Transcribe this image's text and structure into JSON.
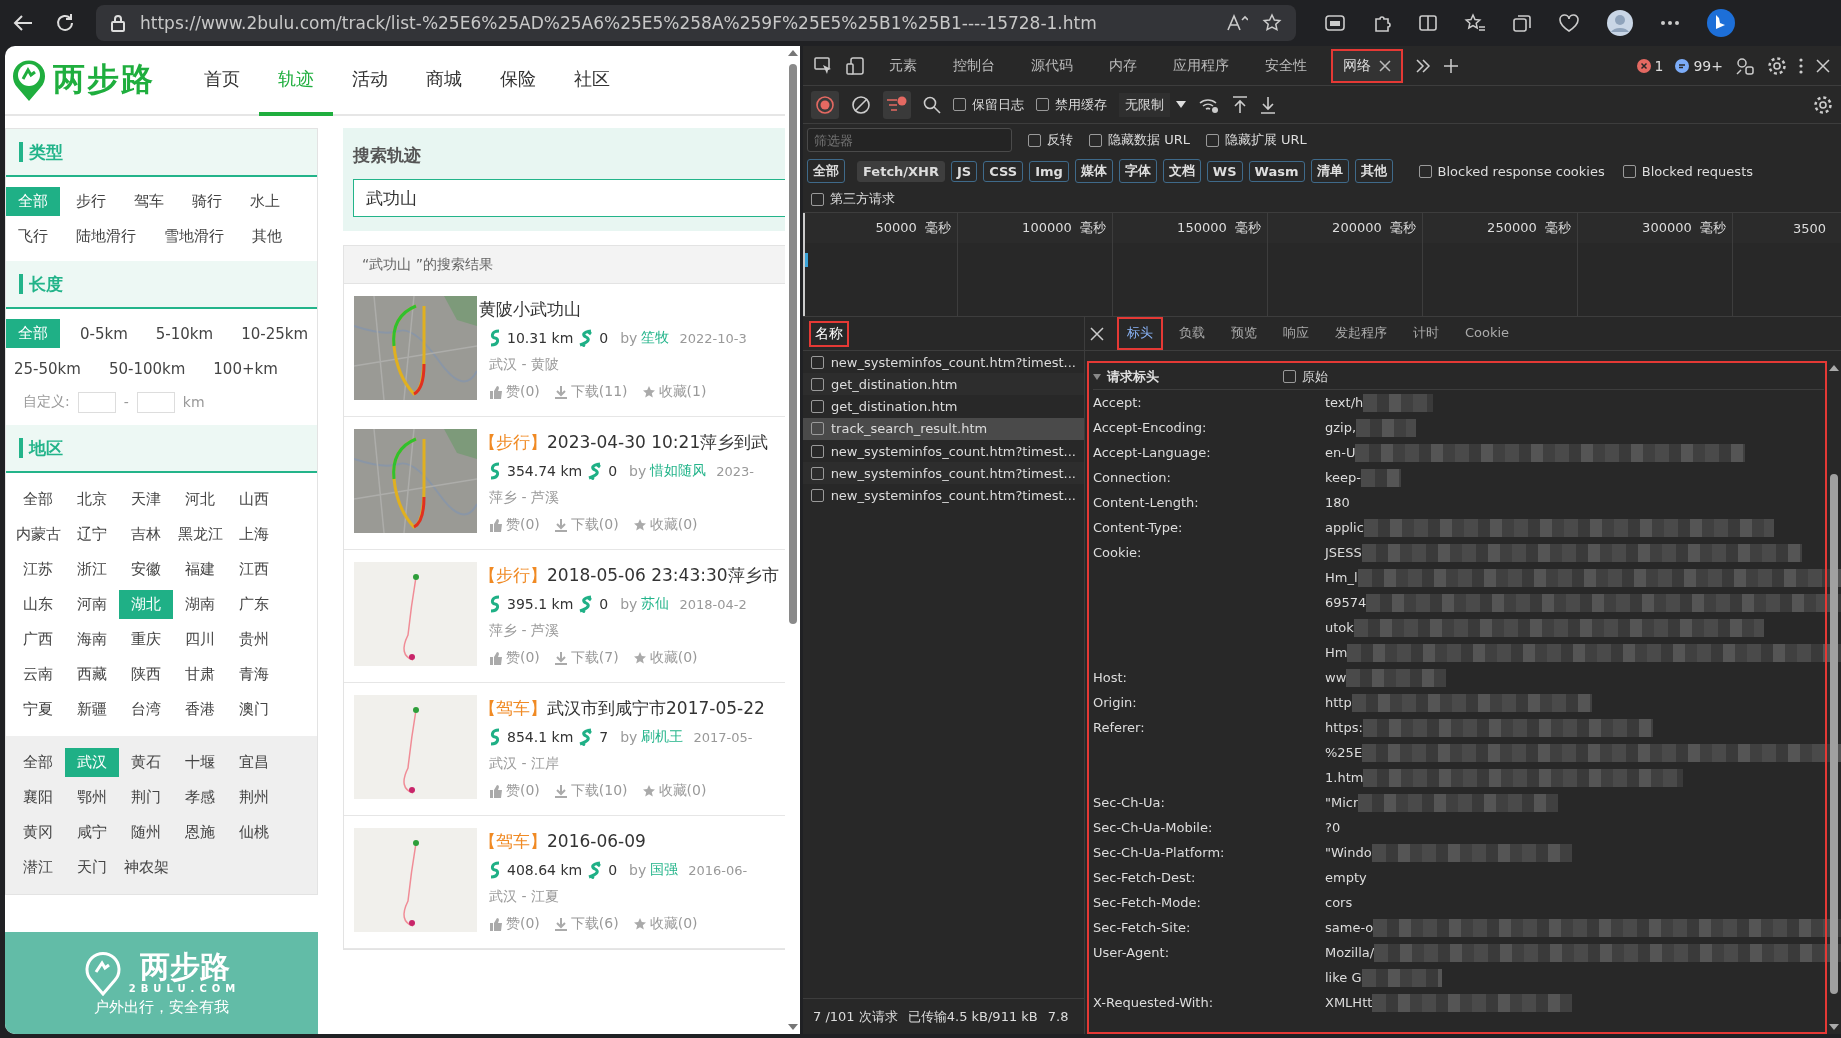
{
  "browser": {
    "url": "https://www.2bulu.com/track/list-%25E6%25AD%25A6%25E5%258A%259F%25E5%25B1%25B1----15728-1.htm"
  },
  "site": {
    "logo": "两步路",
    "nav": [
      {
        "label": "首页",
        "selected": false
      },
      {
        "label": "轨迹",
        "selected": true
      },
      {
        "label": "活动",
        "selected": false
      },
      {
        "label": "商城",
        "selected": false
      },
      {
        "label": "保险",
        "selected": false
      },
      {
        "label": "社区",
        "selected": false
      }
    ],
    "filters": [
      {
        "title": "类型",
        "kind": "options",
        "options": [
          {
            "label": "全部",
            "selected": true
          },
          {
            "label": "步行",
            "selected": false
          },
          {
            "label": "驾车",
            "selected": false
          },
          {
            "label": "骑行",
            "selected": false
          },
          {
            "label": "水上",
            "selected": false
          },
          {
            "label": "飞行",
            "selected": false
          },
          {
            "label": "陆地滑行",
            "selected": false
          },
          {
            "label": "雪地滑行",
            "selected": false
          },
          {
            "label": "其他",
            "selected": false
          }
        ]
      },
      {
        "title": "长度",
        "kind": "options",
        "options": [
          {
            "label": "全部",
            "selected": true
          },
          {
            "label": "0-5km",
            "selected": false
          },
          {
            "label": "5-10km",
            "selected": false
          },
          {
            "label": "10-25km",
            "selected": false
          },
          {
            "label": "25-50km",
            "selected": false
          },
          {
            "label": "50-100km",
            "selected": false
          },
          {
            "label": "100+km",
            "selected": false
          }
        ],
        "custom": {
          "label": "自定义:",
          "separator": "-",
          "unit": "km"
        }
      },
      {
        "title": "地区",
        "kind": "grid",
        "provinces": [
          {
            "label": "全部",
            "selected": false
          },
          {
            "label": "北京",
            "selected": false
          },
          {
            "label": "天津",
            "selected": false
          },
          {
            "label": "河北",
            "selected": false
          },
          {
            "label": "山西",
            "selected": false
          },
          {
            "label": "内蒙古",
            "selected": false
          },
          {
            "label": "辽宁",
            "selected": false
          },
          {
            "label": "吉林",
            "selected": false
          },
          {
            "label": "黑龙江",
            "selected": false
          },
          {
            "label": "上海",
            "selected": false
          },
          {
            "label": "江苏",
            "selected": false
          },
          {
            "label": "浙江",
            "selected": false
          },
          {
            "label": "安徽",
            "selected": false
          },
          {
            "label": "福建",
            "selected": false
          },
          {
            "label": "江西",
            "selected": false
          },
          {
            "label": "山东",
            "selected": false
          },
          {
            "label": "河南",
            "selected": false
          },
          {
            "label": "湖北",
            "selected": true
          },
          {
            "label": "湖南",
            "selected": false
          },
          {
            "label": "广东",
            "selected": false
          },
          {
            "label": "广西",
            "selected": false
          },
          {
            "label": "海南",
            "selected": false
          },
          {
            "label": "重庆",
            "selected": false
          },
          {
            "label": "四川",
            "selected": false
          },
          {
            "label": "贵州",
            "selected": false
          },
          {
            "label": "云南",
            "selected": false
          },
          {
            "label": "西藏",
            "selected": false
          },
          {
            "label": "陕西",
            "selected": false
          },
          {
            "label": "甘肃",
            "selected": false
          },
          {
            "label": "青海",
            "selected": false
          },
          {
            "label": "宁夏",
            "selected": false
          },
          {
            "label": "新疆",
            "selected": false
          },
          {
            "label": "台湾",
            "selected": false
          },
          {
            "label": "香港",
            "selected": false
          },
          {
            "label": "澳门",
            "selected": false
          }
        ],
        "cities": [
          {
            "label": "全部",
            "selected": false
          },
          {
            "label": "武汉",
            "selected": true
          },
          {
            "label": "黄石",
            "selected": false
          },
          {
            "label": "十堰",
            "selected": false
          },
          {
            "label": "宜昌",
            "selected": false
          },
          {
            "label": "襄阳",
            "selected": false
          },
          {
            "label": "鄂州",
            "selected": false
          },
          {
            "label": "荆门",
            "selected": false
          },
          {
            "label": "孝感",
            "selected": false
          },
          {
            "label": "荆州",
            "selected": false
          },
          {
            "label": "黄冈",
            "selected": false
          },
          {
            "label": "咸宁",
            "selected": false
          },
          {
            "label": "随州",
            "selected": false
          },
          {
            "label": "恩施",
            "selected": false
          },
          {
            "label": "仙桃",
            "selected": false
          },
          {
            "label": "潜江",
            "selected": false
          },
          {
            "label": "天门",
            "selected": false
          },
          {
            "label": "神农架",
            "selected": false
          }
        ]
      }
    ],
    "banner": {
      "logo": "两步路",
      "domain": "2BULU.COM",
      "slogan": "户外出行，安全有我"
    },
    "search": {
      "title": "搜索轨迹",
      "value": "武功山"
    },
    "results_heading": "“武功山 ”的搜索结果",
    "results": [
      {
        "title": "黄陂小武功山",
        "distance": "10.31 km",
        "count": "0",
        "by": "by",
        "author": "笙牧",
        "date": "2022-10-3",
        "route": "武汉 - 黄陂",
        "likes": "赞(0)",
        "downloads": "下载(11)",
        "favorites": "收藏(1)"
      },
      {
        "type": "【步行】",
        "title": "2023-04-30 10:21萍乡到武",
        "distance": "354.74 km",
        "count": "0",
        "by": "by",
        "author": "惜如随风",
        "date": "2023-",
        "route": "萍乡 - 芦溪",
        "likes": "赞(0)",
        "downloads": "下载(0)",
        "favorites": "收藏(0)"
      },
      {
        "type": "【步行】",
        "title": "2018-05-06 23:43:30萍乡市",
        "distance": "395.1 km",
        "count": "0",
        "by": "by",
        "author": "苏仙",
        "date": "2018-04-2",
        "route": "萍乡 - 芦溪",
        "likes": "赞(0)",
        "downloads": "下载(7)",
        "favorites": "收藏(0)"
      },
      {
        "type": "【驾车】",
        "title": "武汉市到咸宁市2017-05-22",
        "distance": "854.1 km",
        "count": "7",
        "by": "by",
        "author": "刷机王",
        "date": "2017-05-",
        "route": "武汉 - 江岸",
        "likes": "赞(0)",
        "downloads": "下载(10)",
        "favorites": "收藏(0)"
      },
      {
        "type": "【驾车】",
        "title": "2016-06-09",
        "distance": "408.64 km",
        "count": "0",
        "by": "by",
        "author": "国强",
        "date": "2016-06-",
        "route": "武汉 - 江夏",
        "likes": "赞(0)",
        "downloads": "下载(6)",
        "favorites": "收藏(0)"
      }
    ]
  },
  "devtools": {
    "tabs": [
      {
        "label": "元素",
        "selected": false,
        "highlighted": false
      },
      {
        "label": "控制台",
        "selected": false,
        "highlighted": false
      },
      {
        "label": "源代码",
        "selected": false,
        "highlighted": false
      },
      {
        "label": "内存",
        "selected": false,
        "highlighted": false
      },
      {
        "label": "应用程序",
        "selected": false,
        "highlighted": false
      },
      {
        "label": "安全性",
        "selected": false,
        "highlighted": false
      },
      {
        "label": "网络",
        "selected": true,
        "highlighted": true
      }
    ],
    "errors": "1",
    "messages": "99+",
    "preserve_log": {
      "label": "保留日志",
      "checked": false
    },
    "disable_cache": {
      "label": "禁用缓存",
      "checked": false
    },
    "throttling": "无限制",
    "filter_placeholder": "筛选器",
    "filter_options": [
      {
        "label": "反转",
        "checked": false
      },
      {
        "label": "隐藏数据 URL",
        "checked": false
      },
      {
        "label": "隐藏扩展 URL",
        "checked": false
      }
    ],
    "types": [
      {
        "label": "全部",
        "selected": false
      },
      {
        "label": "Fetch/XHR",
        "selected": true
      },
      {
        "label": "JS",
        "selected": false
      },
      {
        "label": "CSS",
        "selected": false
      },
      {
        "label": "Img",
        "selected": false
      },
      {
        "label": "媒体",
        "selected": false
      },
      {
        "label": "字体",
        "selected": false
      },
      {
        "label": "文档",
        "selected": false
      },
      {
        "label": "WS",
        "selected": false
      },
      {
        "label": "Wasm",
        "selected": false
      },
      {
        "label": "清单",
        "selected": false
      },
      {
        "label": "其他",
        "selected": false
      }
    ],
    "type_options": [
      {
        "label": "Blocked response cookies",
        "checked": false
      },
      {
        "label": "Blocked requests",
        "checked": false
      }
    ],
    "third_party": {
      "label": "第三方请求",
      "checked": false
    },
    "timeline_ticks": [
      "50000  毫秒",
      "100000  毫秒",
      "150000  毫秒",
      "200000  毫秒",
      "250000  毫秒",
      "300000  毫秒",
      "3500"
    ],
    "name_header": {
      "label": "名称",
      "highlighted": true
    },
    "requests": [
      {
        "name": "new_systeminfos_count.htm?timest...",
        "selected": false
      },
      {
        "name": "get_distination.htm",
        "selected": false
      },
      {
        "name": "get_distination.htm",
        "selected": false
      },
      {
        "name": "track_search_result.htm",
        "selected": true
      },
      {
        "name": "new_systeminfos_count.htm?timest...",
        "selected": false
      },
      {
        "name": "new_systeminfos_count.htm?timest...",
        "selected": false
      },
      {
        "name": "new_systeminfos_count.htm?timest...",
        "selected": false
      }
    ],
    "summary": [
      "7 /101 次请求",
      "已传输4.5 kB/911 kB",
      "7.8"
    ],
    "detail_tabs": [
      {
        "label": "标头",
        "selected": true,
        "highlighted": true
      },
      {
        "label": "负载",
        "selected": false,
        "highlighted": false
      },
      {
        "label": "预览",
        "selected": false,
        "highlighted": false
      },
      {
        "label": "响应",
        "selected": false,
        "highlighted": false
      },
      {
        "label": "发起程序",
        "selected": false,
        "highlighted": false
      },
      {
        "label": "计时",
        "selected": false,
        "highlighted": false
      },
      {
        "label": "Cookie",
        "selected": false,
        "highlighted": false
      }
    ],
    "headers_section": {
      "title": "请求标头",
      "expanded": true,
      "highlighted": true,
      "raw": {
        "label": "原始",
        "checked": false
      }
    },
    "headers": [
      {
        "name": "Accept:",
        "values": [
          {
            "text": "text/h",
            "redacted": true
          }
        ]
      },
      {
        "name": "Accept-Encoding:",
        "values": [
          {
            "text": "gzip,",
            "redacted": true
          }
        ]
      },
      {
        "name": "Accept-Language:",
        "values": [
          {
            "text": "en-U",
            "redacted": true
          }
        ]
      },
      {
        "name": "Connection:",
        "values": [
          {
            "text": "keep-",
            "redacted": true
          }
        ]
      },
      {
        "name": "Content-Length:",
        "values": [
          {
            "text": "180",
            "redacted": false
          }
        ]
      },
      {
        "name": "Content-Type:",
        "values": [
          {
            "text": "applic",
            "redacted": true
          }
        ]
      },
      {
        "name": "Cookie:",
        "values": [
          {
            "text": "JSESS",
            "redacted": true
          },
          {
            "text": "Hm_l",
            "redacted": true
          },
          {
            "text": "69574",
            "redacted": true
          },
          {
            "text": "utok",
            "redacted": true
          },
          {
            "text": "Hm",
            "redacted": true
          }
        ]
      },
      {
        "name": "Host:",
        "values": [
          {
            "text": "ww",
            "redacted": true
          }
        ]
      },
      {
        "name": "Origin:",
        "values": [
          {
            "text": "http",
            "redacted": true
          }
        ]
      },
      {
        "name": "Referer:",
        "values": [
          {
            "text": "https:",
            "redacted": true
          },
          {
            "text": "%25E",
            "redacted": true
          },
          {
            "text": "1.htm",
            "redacted": true
          }
        ]
      },
      {
        "name": "Sec-Ch-Ua:",
        "values": [
          {
            "text": "\"Micr",
            "redacted": true
          }
        ]
      },
      {
        "name": "Sec-Ch-Ua-Mobile:",
        "values": [
          {
            "text": "?0",
            "redacted": false
          }
        ]
      },
      {
        "name": "Sec-Ch-Ua-Platform:",
        "values": [
          {
            "text": "\"Windo",
            "redacted": true
          }
        ]
      },
      {
        "name": "Sec-Fetch-Dest:",
        "values": [
          {
            "text": "empty",
            "redacted": false
          }
        ]
      },
      {
        "name": "Sec-Fetch-Mode:",
        "values": [
          {
            "text": "cors",
            "redacted": false
          }
        ]
      },
      {
        "name": "Sec-Fetch-Site:",
        "values": [
          {
            "text": "same-o",
            "redacted": true
          }
        ]
      },
      {
        "name": "User-Agent:",
        "values": [
          {
            "text": "Mozilla/",
            "redacted": true
          },
          {
            "text": "like G",
            "redacted": true
          }
        ]
      },
      {
        "name": "X-Requested-With:",
        "values": [
          {
            "text": "XMLHtt",
            "redacted": true
          }
        ]
      }
    ]
  }
}
